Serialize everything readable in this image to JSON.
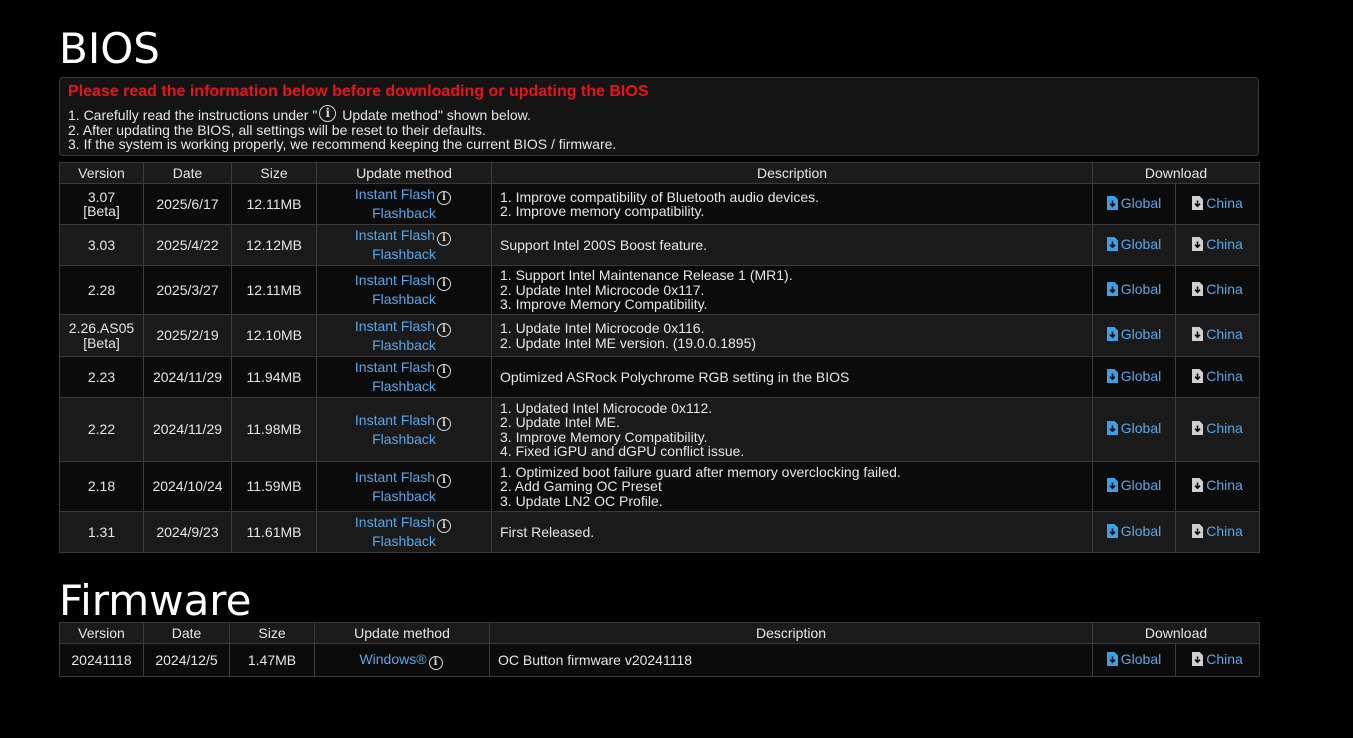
{
  "bios": {
    "heading": "BIOS",
    "notice": {
      "title": "Please read the information below before downloading or updating the BIOS",
      "line1_pre": "1. Carefully read the instructions under \"",
      "line1_post": " Update method\" shown below.",
      "line2": "2. After updating the BIOS, all settings will be reset to their defaults.",
      "line3": "3. If the system is working properly, we recommend keeping the current BIOS / firmware."
    },
    "headers": [
      "Version",
      "Date",
      "Size",
      "Update method",
      "Description",
      "Download"
    ],
    "rows": [
      {
        "version": [
          "3.07",
          "[Beta]"
        ],
        "date": "2025/6/17",
        "size": "12.11MB",
        "methods": [
          "Instant Flash",
          "Flashback"
        ],
        "desc": [
          "1. Improve compatibility of Bluetooth audio devices.",
          "2. Improve memory compatibility."
        ],
        "global": "Global",
        "china": "China"
      },
      {
        "version": [
          "3.03"
        ],
        "date": "2025/4/22",
        "size": "12.12MB",
        "methods": [
          "Instant Flash",
          "Flashback"
        ],
        "desc": [
          "Support Intel 200S Boost feature."
        ],
        "global": "Global",
        "china": "China"
      },
      {
        "version": [
          "2.28"
        ],
        "date": "2025/3/27",
        "size": "12.11MB",
        "methods": [
          "Instant Flash",
          "Flashback"
        ],
        "desc": [
          "1. Support Intel Maintenance Release 1 (MR1).",
          "2. Update Intel Microcode 0x117.",
          "3. Improve Memory Compatibility."
        ],
        "global": "Global",
        "china": "China"
      },
      {
        "version": [
          "2.26.AS05",
          "[Beta]"
        ],
        "date": "2025/2/19",
        "size": "12.10MB",
        "methods": [
          "Instant Flash",
          "Flashback"
        ],
        "desc": [
          "1. Update Intel Microcode 0x116.",
          "2. Update Intel ME version. (19.0.0.1895)"
        ],
        "global": "Global",
        "china": "China"
      },
      {
        "version": [
          "2.23"
        ],
        "date": "2024/11/29",
        "size": "11.94MB",
        "methods": [
          "Instant Flash",
          "Flashback"
        ],
        "desc": [
          "Optimized ASRock Polychrome RGB setting in the BIOS"
        ],
        "global": "Global",
        "china": "China"
      },
      {
        "version": [
          "2.22"
        ],
        "date": "2024/11/29",
        "size": "11.98MB",
        "methods": [
          "Instant Flash",
          "Flashback"
        ],
        "desc": [
          "1. Updated Intel Microcode 0x112.",
          "2. Update Intel ME.",
          "3. Improve Memory Compatibility.",
          "4. Fixed iGPU and dGPU conflict issue."
        ],
        "global": "Global",
        "china": "China"
      },
      {
        "version": [
          "2.18"
        ],
        "date": "2024/10/24",
        "size": "11.59MB",
        "methods": [
          "Instant Flash",
          "Flashback"
        ],
        "desc": [
          "1. Optimized boot failure guard after memory overclocking failed.",
          "2. Add Gaming OC Preset",
          "3. Update LN2 OC Profile."
        ],
        "global": "Global",
        "china": "China"
      },
      {
        "version": [
          "1.31"
        ],
        "date": "2024/9/23",
        "size": "11.61MB",
        "methods": [
          "Instant Flash",
          "Flashback"
        ],
        "desc": [
          "First Released."
        ],
        "global": "Global",
        "china": "China"
      }
    ]
  },
  "firmware": {
    "heading": "Firmware",
    "headers": [
      "Version",
      "Date",
      "Size",
      "Update method",
      "Description",
      "Download"
    ],
    "rows": [
      {
        "version": [
          "20241118"
        ],
        "date": "2024/12/5",
        "size": "1.47MB",
        "methods": [
          "Windows®"
        ],
        "desc": [
          "OC Button firmware v20241118"
        ],
        "global": "Global",
        "china": "China"
      }
    ]
  },
  "colors": {
    "link": "#58a7e8",
    "warning": "#e8141c",
    "global_icon": "#3aa0e8",
    "china_icon": "#cfcfcf"
  },
  "icons": {
    "info": "info-circle-icon",
    "download": "file-download-icon"
  }
}
